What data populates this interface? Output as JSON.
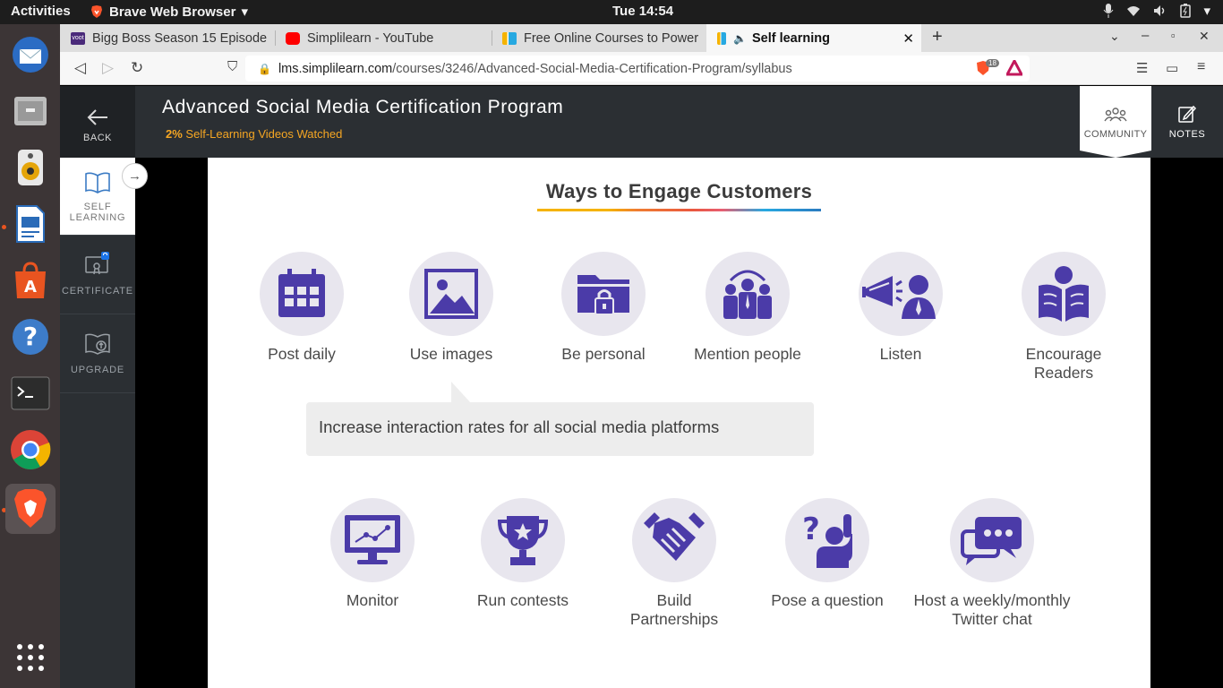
{
  "system": {
    "activities": "Activities",
    "app_name": "Brave Web Browser",
    "clock": "Tue 14:54"
  },
  "tabs": [
    {
      "title": "Bigg Boss Season 15 Episode",
      "favicon": "voot-icon"
    },
    {
      "title": "Simplilearn - YouTube",
      "favicon": "youtube-icon"
    },
    {
      "title": "Free Online Courses to Power",
      "favicon": "simplilearn-icon"
    },
    {
      "title": "Self learning",
      "favicon": "simplilearn-icon",
      "active": true
    }
  ],
  "url": {
    "host": "lms.simplilearn.com",
    "path": "/courses/3246/Advanced-Social-Media-Certification-Program/syllabus"
  },
  "brave_badge_count": "18",
  "header": {
    "back_label": "BACK",
    "course_title": "Advanced Social Media Certification Program",
    "progress_percent": "2%",
    "progress_text": "Self-Learning Videos Watched",
    "community_label": "COMMUNITY",
    "notes_label": "NOTES"
  },
  "sidebar": {
    "items": [
      {
        "line1": "SELF",
        "line2": "LEARNING",
        "icon": "book-icon",
        "active": true
      },
      {
        "line1": "CERTIFICATE",
        "line2": "",
        "icon": "certificate-icon"
      },
      {
        "line1": "UPGRADE",
        "line2": "",
        "icon": "upgrade-icon"
      }
    ]
  },
  "slide": {
    "title": "Ways to Engage Customers",
    "callout": "Increase interaction rates for all social media platforms",
    "row1": [
      {
        "line1": "Post daily",
        "line2": "",
        "icon": "calendar-icon"
      },
      {
        "line1": "Use images",
        "line2": "",
        "icon": "image-icon"
      },
      {
        "line1": "Be personal",
        "line2": "",
        "icon": "locked-folder-icon"
      },
      {
        "line1": "Mention people",
        "line2": "",
        "icon": "people-icon"
      },
      {
        "line1": "Listen",
        "line2": "",
        "icon": "megaphone-icon"
      },
      {
        "line1": "Encourage",
        "line2": "Readers",
        "icon": "reader-icon"
      }
    ],
    "row2": [
      {
        "line1": "Monitor",
        "line2": "",
        "icon": "monitor-icon"
      },
      {
        "line1": "Run contests",
        "line2": "",
        "icon": "trophy-icon"
      },
      {
        "line1": "Build",
        "line2": "Partnerships",
        "icon": "handshake-icon"
      },
      {
        "line1": "Pose a question",
        "line2": "",
        "icon": "question-icon"
      },
      {
        "line1": "Host a weekly/monthly",
        "line2": "Twitter chat",
        "icon": "chat-icon"
      }
    ]
  },
  "colors": {
    "icon_purple": "#4b3ba8",
    "circle_bg": "#e8e6ee",
    "header_bg": "#2b2f33",
    "progress_orange": "#f5a623"
  }
}
